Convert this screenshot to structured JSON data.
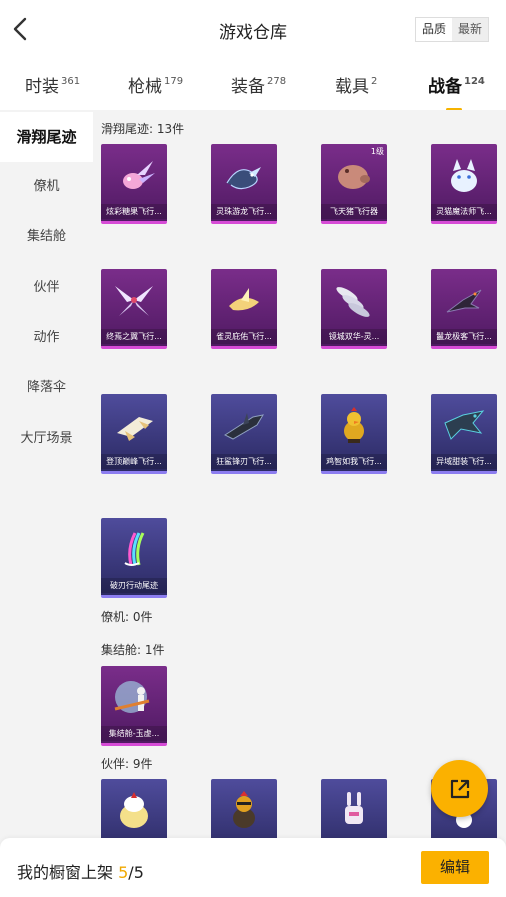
{
  "header": {
    "title": "游戏仓库",
    "sort_options": [
      "品质",
      "最新"
    ],
    "active_sort": "最新"
  },
  "tabs": [
    {
      "label": "时装",
      "count": "361"
    },
    {
      "label": "枪械",
      "count": "179"
    },
    {
      "label": "装备",
      "count": "278"
    },
    {
      "label": "载具",
      "count": "2"
    },
    {
      "label": "战备",
      "count": "124",
      "active": true
    }
  ],
  "sidebar": {
    "items": [
      "滑翔尾迹",
      "僚机",
      "集结舱",
      "伙伴",
      "动作",
      "降落伞",
      "大厅场景"
    ],
    "active": "滑翔尾迹"
  },
  "sections": {
    "glide": {
      "label": "滑翔尾迹: 13件",
      "items": [
        {
          "name": "炫彩糖果飞行...",
          "icon": "pink-creature-icon"
        },
        {
          "name": "灵珠游龙飞行...",
          "icon": "dragon-icon"
        },
        {
          "name": "飞天猪飞行器",
          "icon": "pig-icon",
          "badge": "1级"
        },
        {
          "name": "灵猫魔法师飞...",
          "icon": "white-cat-icon"
        },
        {
          "name": "终焉之翼飞行...",
          "icon": "wings-icon"
        },
        {
          "name": "雀灵庇佑飞行...",
          "icon": "golden-bird-icon"
        },
        {
          "name": "镜城双华-灵...",
          "icon": "feathers-icon"
        },
        {
          "name": "鬣龙极客飞行...",
          "icon": "dark-dragon-icon"
        },
        {
          "name": "登顶巅峰飞行...",
          "icon": "jet-icon"
        },
        {
          "name": "狂鲨锋刃飞行...",
          "icon": "shark-jet-icon"
        },
        {
          "name": "鸡智如我飞行...",
          "icon": "chicken-icon"
        },
        {
          "name": "异域甜装飞行...",
          "icon": "mech-dragon-icon"
        },
        {
          "name": "破刃行动尾迹",
          "icon": "rainbow-trail-icon"
        }
      ]
    },
    "wingman": {
      "label": "僚机: 0件"
    },
    "pod": {
      "label": "集结舱: 1件",
      "items": [
        {
          "name": "集结舱-玉虚...",
          "icon": "pod-icon"
        }
      ]
    },
    "partner": {
      "label": "伙伴: 9件",
      "items": [
        {
          "name": "",
          "icon": "chick-icon"
        },
        {
          "name": "",
          "icon": "rooster-icon"
        },
        {
          "name": "",
          "icon": "robot-rabbit-icon"
        },
        {
          "name": "",
          "icon": "mascot-icon"
        }
      ]
    }
  },
  "footer": {
    "label": "我的橱窗上架",
    "current": "5",
    "separator_total": "/5",
    "edit_label": "编辑"
  },
  "colors": {
    "accent": "#fbb100",
    "card_purple": "#6a2579",
    "card_blue": "#3d3b82"
  }
}
